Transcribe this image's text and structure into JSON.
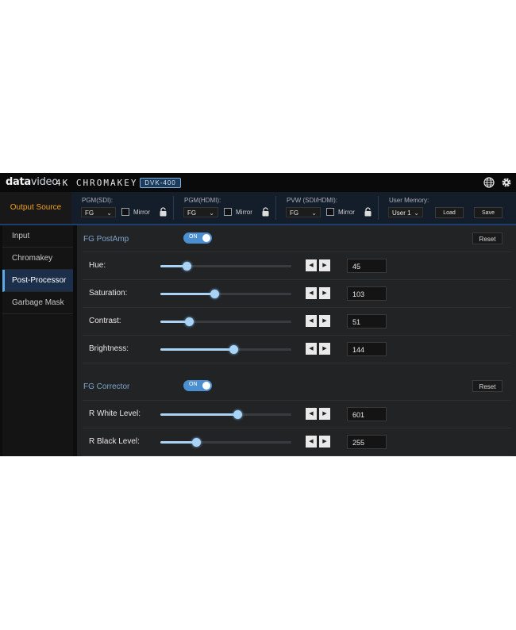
{
  "header": {
    "logo_main": "data",
    "logo_sub": "video",
    "product": "4K CHROMAKEY",
    "model": "DVK-400"
  },
  "output_bar": {
    "output_source_label": "Output Source",
    "pgm_sdi": {
      "label": "PGM(SDI):",
      "value": "FG",
      "mirror": "Mirror",
      "mirror_checked": false
    },
    "pgm_hdmi": {
      "label": "PGM(HDMI):",
      "value": "FG",
      "mirror": "Mirror",
      "mirror_checked": false
    },
    "pvw": {
      "label": "PVW (SDI/HDMI):",
      "value": "FG",
      "mirror": "Mirror",
      "mirror_checked": false
    },
    "user_memory": {
      "label": "User Memory:",
      "value": "User 1",
      "load": "Load",
      "save": "Save"
    }
  },
  "sidebar": {
    "items": [
      {
        "label": "Input",
        "active": false
      },
      {
        "label": "Chromakey",
        "active": false
      },
      {
        "label": "Post-Processor",
        "active": true
      },
      {
        "label": "Garbage Mask",
        "active": false
      }
    ]
  },
  "main": {
    "postamp": {
      "title": "FG PostAmp",
      "toggle": "ON",
      "reset": "Reset",
      "params": [
        {
          "label": "Hue:",
          "value": "45",
          "level": 0.2
        },
        {
          "label": "Saturation:",
          "value": "103",
          "level": 0.41
        },
        {
          "label": "Contrast:",
          "value": "51",
          "level": 0.22
        },
        {
          "label": "Brightness:",
          "value": "144",
          "level": 0.56
        }
      ]
    },
    "corrector": {
      "title": "FG Corrector",
      "toggle": "ON",
      "reset": "Reset",
      "params": [
        {
          "label": "R White Level:",
          "value": "601",
          "level": 0.59
        },
        {
          "label": "R Black Level:",
          "value": "255",
          "level": 0.27
        }
      ]
    }
  },
  "colors": {
    "accent_blue": "#4b8fd0",
    "slider_fill": "#a9d4f5",
    "output_source": "#f0a020",
    "section_title": "#7fa6cc"
  }
}
